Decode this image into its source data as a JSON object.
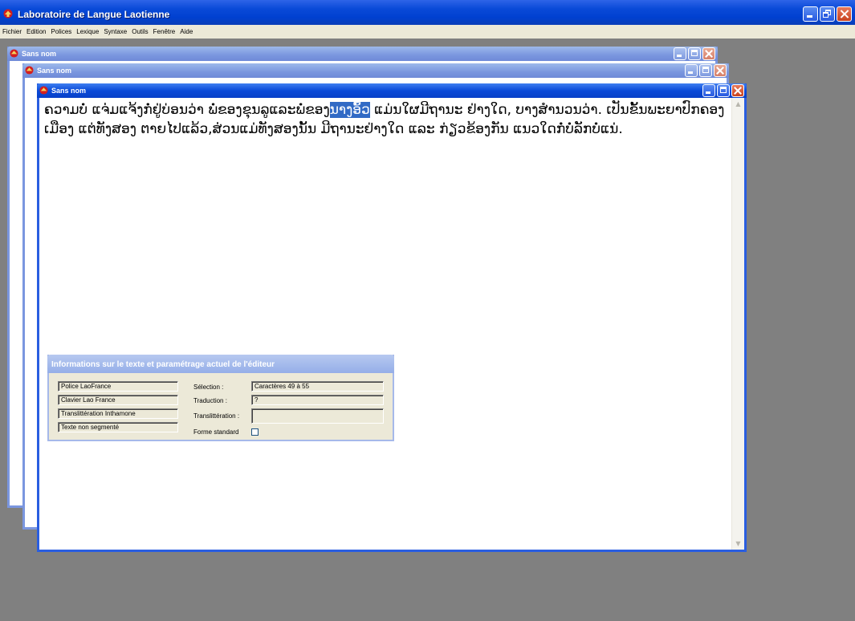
{
  "app": {
    "title": "Laboratoire de Langue Laotienne"
  },
  "menu": [
    "Fichier",
    "Edition",
    "Polices",
    "Lexique",
    "Syntaxe",
    "Outils",
    "Fenêtre",
    "Aide"
  ],
  "windows": {
    "back_title": "Sans nom",
    "middle_title": "Sans nom",
    "front_title": "Sans nom"
  },
  "editor": {
    "text_before_selection": "ຄວາມບໍ່ ແຈ່ມແຈ້ງກໍ່ຢູ່ບ່ອນວ່າ ພໍ່ຂອງຂຸນລູແລະພໍ່ຂອງ",
    "selected_text": "ນາງອົ້ວ",
    "text_after_selection": " ແມ່ນໃຜມີຖານະ ຢ່າງໃດ, ບາງສຳນວນວ່າ. ເປັນຂັ້ນພະຍາປົກຄອງເມືອງ ແຕ່ທັງສອງ ຕາຍໄປແລ້ວ,ສ່ວນແມ່ທັງສອງນັ້ນ ມີຖານະຢ່າງໃດ ແລະ ກ່ຽວຂ້ອງກັນ ແນວໃດກໍ່ບໍ່ລັກບໍ່ແນ່."
  },
  "info_panel": {
    "title": "Informations sur le texte et paramétrage actuel de l'éditeur",
    "police": "Police LaoFrance",
    "clavier": "Clavier Lao France",
    "translit_left": "Translittération Inthamone",
    "segmentation": "Texte non segmenté",
    "selection_label": "Sélection :",
    "selection_value": "Caractères 49 à 55",
    "traduction_label": "Traduction :",
    "traduction_value": "?",
    "translit_label": "Translittération :",
    "translit_value": "",
    "forme_label": "Forme standard",
    "forme_checked": false
  }
}
